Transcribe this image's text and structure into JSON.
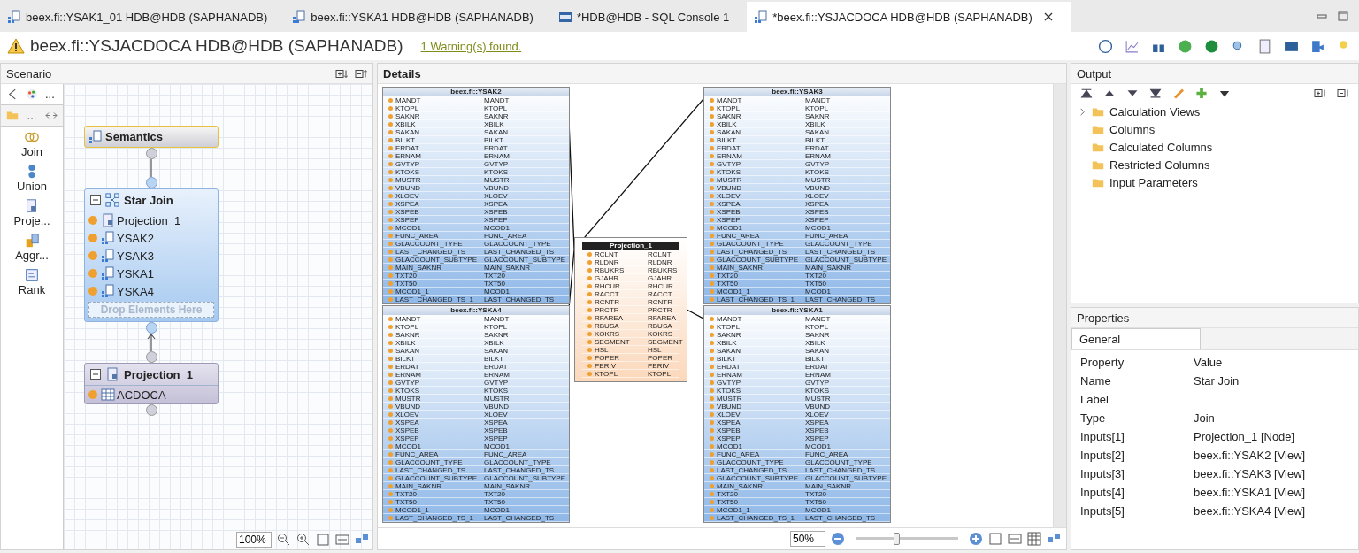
{
  "tabs": [
    {
      "label": "beex.fi::YSAK1_01 HDB@HDB (SAPHANADB)",
      "kind": "view",
      "selected": false
    },
    {
      "label": "beex.fi::YSKA1 HDB@HDB (SAPHANADB)",
      "kind": "view",
      "selected": false
    },
    {
      "label": "*HDB@HDB - SQL Console 1",
      "kind": "sql",
      "selected": false
    },
    {
      "label": "*beex.fi::YSJACDOCA HDB@HDB (SAPHANADB)",
      "kind": "view",
      "selected": true
    }
  ],
  "editor": {
    "title": "beex.fi::YSJACDOCA HDB@HDB (SAPHANADB)",
    "warning_link": "1 Warning(s) found."
  },
  "scenario": {
    "title": "Scenario",
    "palette_more": "...",
    "folder_label": "...",
    "palette": [
      {
        "label": "Join",
        "kind": "join"
      },
      {
        "label": "Union",
        "kind": "union"
      },
      {
        "label": "Proje...",
        "kind": "projection"
      },
      {
        "label": "Aggr...",
        "kind": "aggregation"
      },
      {
        "label": "Rank",
        "kind": "rank"
      }
    ],
    "semantics": {
      "title": "Semantics"
    },
    "star_join": {
      "title": "Star Join",
      "drop_hint": "Drop Elements Here",
      "inputs": [
        {
          "label": "Projection_1",
          "kind": "projection"
        },
        {
          "label": "YSAK2",
          "kind": "view"
        },
        {
          "label": "YSAK3",
          "kind": "view"
        },
        {
          "label": "YSKA1",
          "kind": "view"
        },
        {
          "label": "YSKA4",
          "kind": "view"
        }
      ]
    },
    "projection": {
      "title": "Projection_1",
      "inputs": [
        {
          "label": "ACDOCA",
          "kind": "table"
        }
      ]
    },
    "zoom": "100%"
  },
  "details": {
    "title": "Details",
    "zoom": "50%",
    "zoom_slider": {
      "level": 0.4
    },
    "tables": [
      {
        "title": "beex.fi::YSAK2",
        "columns": [
          [
            "MANDT",
            "MANDT"
          ],
          [
            "KTOPL",
            "KTOPL"
          ],
          [
            "SAKNR",
            "SAKNR"
          ],
          [
            "XBILK",
            "XBILK"
          ],
          [
            "SAKAN",
            "SAKAN"
          ],
          [
            "BILKT",
            "BILKT"
          ],
          [
            "ERDAT",
            "ERDAT"
          ],
          [
            "ERNAM",
            "ERNAM"
          ],
          [
            "GVTYP",
            "GVTYP"
          ],
          [
            "KTOKS",
            "KTOKS"
          ],
          [
            "MUSTR",
            "MUSTR"
          ],
          [
            "VBUND",
            "VBUND"
          ],
          [
            "XLOEV",
            "XLOEV"
          ],
          [
            "XSPEA",
            "XSPEA"
          ],
          [
            "XSPEB",
            "XSPEB"
          ],
          [
            "XSPEP",
            "XSPEP"
          ],
          [
            "MCOD1",
            "MCOD1"
          ],
          [
            "FUNC_AREA",
            "FUNC_AREA"
          ],
          [
            "GLACCOUNT_TYPE",
            "GLACCOUNT_TYPE"
          ],
          [
            "LAST_CHANGED_TS",
            "LAST_CHANGED_TS"
          ],
          [
            "GLACCOUNT_SUBTYPE",
            "GLACCOUNT_SUBTYPE"
          ],
          [
            "MAIN_SAKNR",
            "MAIN_SAKNR"
          ],
          [
            "TXT20",
            "TXT20"
          ],
          [
            "TXT50",
            "TXT50"
          ],
          [
            "MCOD1_1",
            "MCOD1"
          ],
          [
            "LAST_CHANGED_TS_1",
            "LAST_CHANGED_TS"
          ]
        ]
      },
      {
        "title": "beex.fi::YSAK3",
        "columns": [
          [
            "MANDT",
            "MANDT"
          ],
          [
            "KTOPL",
            "KTOPL"
          ],
          [
            "SAKNR",
            "SAKNR"
          ],
          [
            "XBILK",
            "XBILK"
          ],
          [
            "SAKAN",
            "SAKAN"
          ],
          [
            "BILKT",
            "BILKT"
          ],
          [
            "ERDAT",
            "ERDAT"
          ],
          [
            "ERNAM",
            "ERNAM"
          ],
          [
            "GVTYP",
            "GVTYP"
          ],
          [
            "KTOKS",
            "KTOKS"
          ],
          [
            "MUSTR",
            "MUSTR"
          ],
          [
            "VBUND",
            "VBUND"
          ],
          [
            "XLOEV",
            "XLOEV"
          ],
          [
            "XSPEA",
            "XSPEA"
          ],
          [
            "XSPEB",
            "XSPEB"
          ],
          [
            "XSPEP",
            "XSPEP"
          ],
          [
            "MCOD1",
            "MCOD1"
          ],
          [
            "FUNC_AREA",
            "FUNC_AREA"
          ],
          [
            "GLACCOUNT_TYPE",
            "GLACCOUNT_TYPE"
          ],
          [
            "LAST_CHANGED_TS",
            "LAST_CHANGED_TS"
          ],
          [
            "GLACCOUNT_SUBTYPE",
            "GLACCOUNT_SUBTYPE"
          ],
          [
            "MAIN_SAKNR",
            "MAIN_SAKNR"
          ],
          [
            "TXT20",
            "TXT20"
          ],
          [
            "TXT50",
            "TXT50"
          ],
          [
            "MCOD1_1",
            "MCOD1"
          ],
          [
            "LAST_CHANGED_TS_1",
            "LAST_CHANGED_TS"
          ]
        ]
      },
      {
        "title": "beex.fi::YSKA4",
        "columns": [
          [
            "MANDT",
            "MANDT"
          ],
          [
            "KTOPL",
            "KTOPL"
          ],
          [
            "SAKNR",
            "SAKNR"
          ],
          [
            "XBILK",
            "XBILK"
          ],
          [
            "SAKAN",
            "SAKAN"
          ],
          [
            "BILKT",
            "BILKT"
          ],
          [
            "ERDAT",
            "ERDAT"
          ],
          [
            "ERNAM",
            "ERNAM"
          ],
          [
            "GVTYP",
            "GVTYP"
          ],
          [
            "KTOKS",
            "KTOKS"
          ],
          [
            "MUSTR",
            "MUSTR"
          ],
          [
            "VBUND",
            "VBUND"
          ],
          [
            "XLOEV",
            "XLOEV"
          ],
          [
            "XSPEA",
            "XSPEA"
          ],
          [
            "XSPEB",
            "XSPEB"
          ],
          [
            "XSPEP",
            "XSPEP"
          ],
          [
            "MCOD1",
            "MCOD1"
          ],
          [
            "FUNC_AREA",
            "FUNC_AREA"
          ],
          [
            "GLACCOUNT_TYPE",
            "GLACCOUNT_TYPE"
          ],
          [
            "LAST_CHANGED_TS",
            "LAST_CHANGED_TS"
          ],
          [
            "GLACCOUNT_SUBTYPE",
            "GLACCOUNT_SUBTYPE"
          ],
          [
            "MAIN_SAKNR",
            "MAIN_SAKNR"
          ],
          [
            "TXT20",
            "TXT20"
          ],
          [
            "TXT50",
            "TXT50"
          ],
          [
            "MCOD1_1",
            "MCOD1"
          ],
          [
            "LAST_CHANGED_TS_1",
            "LAST_CHANGED_TS"
          ]
        ]
      },
      {
        "title": "beex.fi::YSKA1",
        "columns": [
          [
            "MANDT",
            "MANDT"
          ],
          [
            "KTOPL",
            "KTOPL"
          ],
          [
            "SAKNR",
            "SAKNR"
          ],
          [
            "XBILK",
            "XBILK"
          ],
          [
            "SAKAN",
            "SAKAN"
          ],
          [
            "BILKT",
            "BILKT"
          ],
          [
            "ERDAT",
            "ERDAT"
          ],
          [
            "ERNAM",
            "ERNAM"
          ],
          [
            "GVTYP",
            "GVTYP"
          ],
          [
            "KTOKS",
            "KTOKS"
          ],
          [
            "MUSTR",
            "MUSTR"
          ],
          [
            "VBUND",
            "VBUND"
          ],
          [
            "XLOEV",
            "XLOEV"
          ],
          [
            "XSPEA",
            "XSPEA"
          ],
          [
            "XSPEB",
            "XSPEB"
          ],
          [
            "XSPEP",
            "XSPEP"
          ],
          [
            "MCOD1",
            "MCOD1"
          ],
          [
            "FUNC_AREA",
            "FUNC_AREA"
          ],
          [
            "GLACCOUNT_TYPE",
            "GLACCOUNT_TYPE"
          ],
          [
            "LAST_CHANGED_TS",
            "LAST_CHANGED_TS"
          ],
          [
            "GLACCOUNT_SUBTYPE",
            "GLACCOUNT_SUBTYPE"
          ],
          [
            "MAIN_SAKNR",
            "MAIN_SAKNR"
          ],
          [
            "TXT20",
            "TXT20"
          ],
          [
            "TXT50",
            "TXT50"
          ],
          [
            "MCOD1_1",
            "MCOD1"
          ],
          [
            "LAST_CHANGED_TS_1",
            "LAST_CHANGED_TS"
          ]
        ]
      }
    ],
    "projection": {
      "title": "Projection_1",
      "columns": [
        [
          "RCLNT",
          "RCLNT"
        ],
        [
          "RLDNR",
          "RLDNR"
        ],
        [
          "RBUKRS",
          "RBUKRS"
        ],
        [
          "GJAHR",
          "GJAHR"
        ],
        [
          "RHCUR",
          "RHCUR"
        ],
        [
          "RACCT",
          "RACCT"
        ],
        [
          "RCNTR",
          "RCNTR"
        ],
        [
          "PRCTR",
          "PRCTR"
        ],
        [
          "RFAREA",
          "RFAREA"
        ],
        [
          "RBUSA",
          "RBUSA"
        ],
        [
          "KOKRS",
          "KOKRS"
        ],
        [
          "SEGMENT",
          "SEGMENT"
        ],
        [
          "HSL",
          "HSL"
        ],
        [
          "POPER",
          "POPER"
        ],
        [
          "PERIV",
          "PERIV"
        ],
        [
          "KTOPL",
          "KTOPL"
        ]
      ]
    }
  },
  "output": {
    "title": "Output",
    "items": [
      {
        "label": "Calculation Views",
        "expandable": true
      },
      {
        "label": "Columns",
        "expandable": false
      },
      {
        "label": "Calculated Columns",
        "expandable": false
      },
      {
        "label": "Restricted Columns",
        "expandable": false
      },
      {
        "label": "Input Parameters",
        "expandable": false
      }
    ]
  },
  "properties": {
    "title": "Properties",
    "tabs": [
      {
        "label": "General",
        "selected": true
      }
    ],
    "headers": [
      "Property",
      "Value"
    ],
    "rows": [
      {
        "property": "Name",
        "value": "Star Join"
      },
      {
        "property": "Label"
      },
      {
        "property": "Type",
        "value": "Join"
      },
      {
        "property": "Inputs[1]",
        "value": "Projection_1 [Node]"
      },
      {
        "property": "Inputs[2]",
        "value": "beex.fi::YSAK2 [View]"
      },
      {
        "property": "Inputs[3]",
        "value": "beex.fi::YSAK3 [View]"
      },
      {
        "property": "Inputs[4]",
        "value": "beex.fi::YSKA1 [View]"
      },
      {
        "property": "Inputs[5]",
        "value": "beex.fi::YSKA4 [View]"
      }
    ]
  }
}
